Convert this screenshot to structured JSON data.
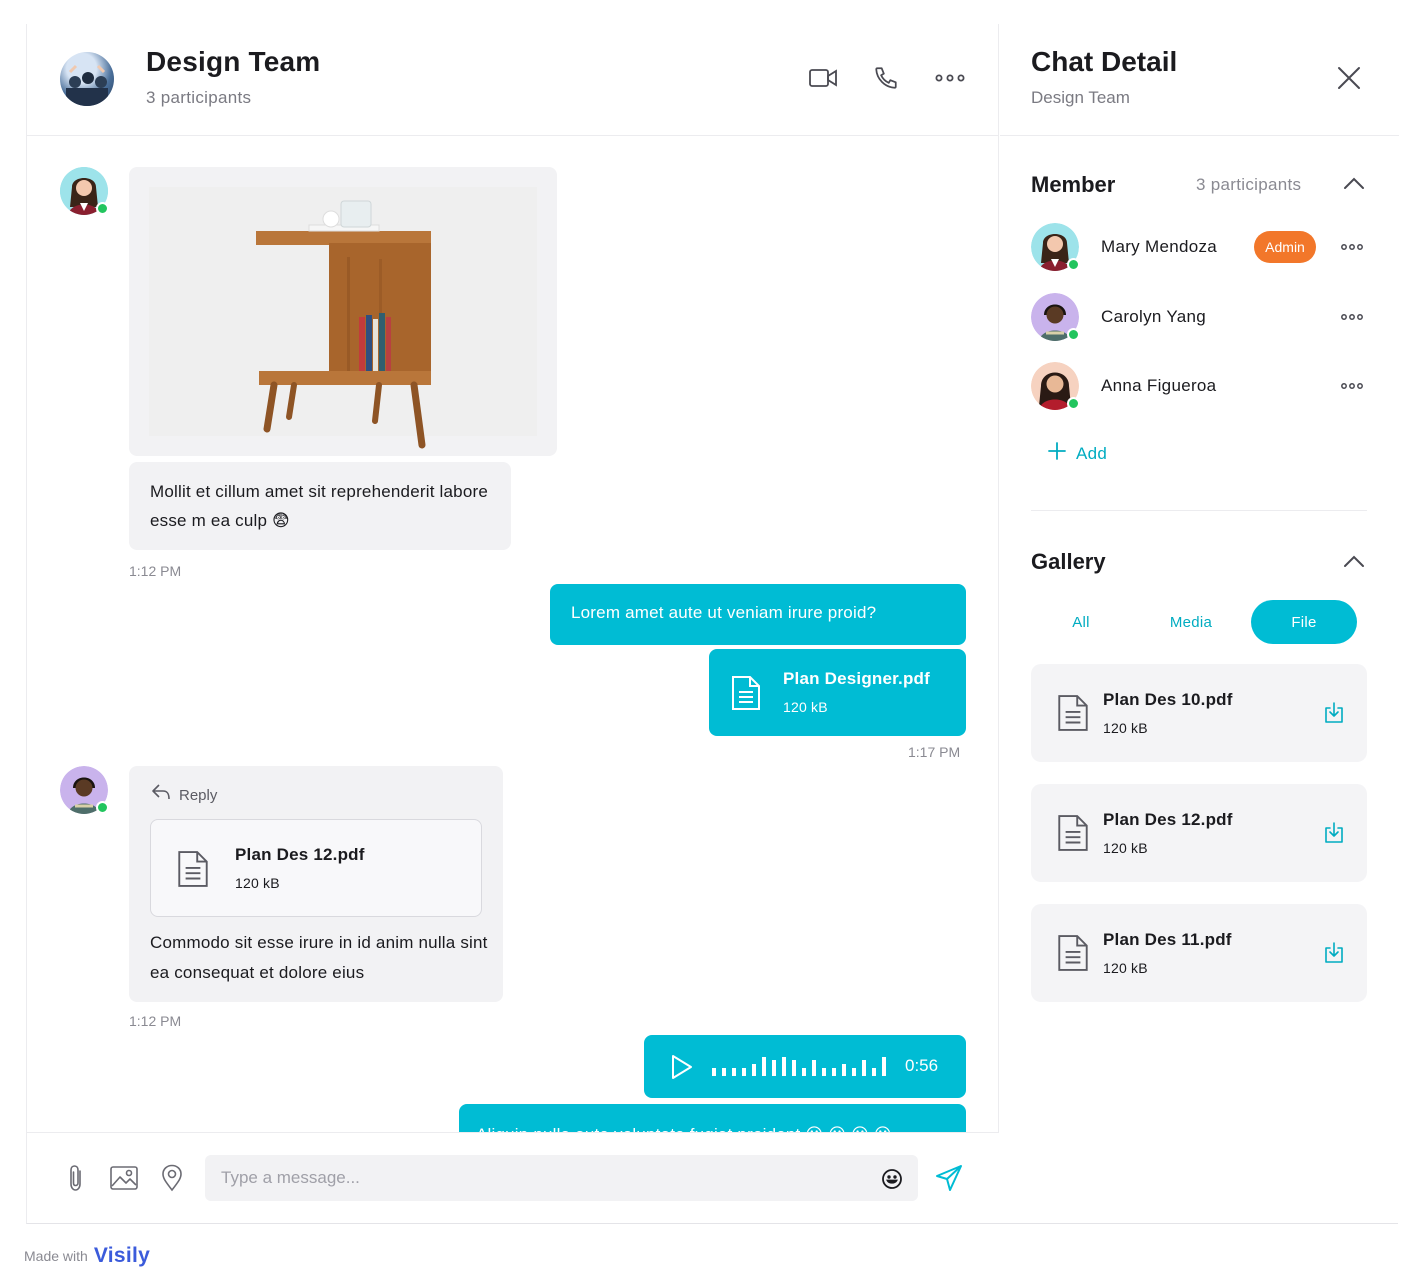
{
  "chat": {
    "title": "Design Team",
    "participants": "3 participants",
    "header_icons": [
      "video-camera-icon",
      "phone-icon",
      "more-horizontal-icon"
    ]
  },
  "messages": {
    "m1_text": "Mollit et cillum amet sit reprehenderit labore esse m ea culp 😨",
    "m1_time": "1:12 PM",
    "m2_text": "Lorem amet aute ut veniam irure proid?",
    "m3_file_name": "Plan Designer.pdf",
    "m3_file_size": "120 kB",
    "m3_time": "1:17 PM",
    "m4_reply_label": "Reply",
    "m4_file_name": "Plan Des 12.pdf",
    "m4_file_size": "120 kB",
    "m4_text": "Commodo sit esse irure in id anim nulla sint ea consequat et dolore eius",
    "m4_time": "1:12 PM",
    "m5_duration": "0:56",
    "m6_text": "Aliquip nulla aute voluptate fugiat proident 😀 😀 😀 😀"
  },
  "composer": {
    "placeholder": "Type a message..."
  },
  "detail": {
    "title": "Chat Detail",
    "subtitle": "Design Team",
    "member_title": "Member",
    "member_count": "3 participants",
    "members": [
      {
        "name": "Mary Mendoza",
        "badge": "Admin"
      },
      {
        "name": "Carolyn Yang"
      },
      {
        "name": "Anna Figueroa"
      }
    ],
    "add_label": "Add",
    "gallery_title": "Gallery",
    "tabs": [
      "All",
      "Media",
      "File"
    ],
    "active_tab": "File",
    "files": [
      {
        "name": "Plan Des 10.pdf",
        "size": "120 kB"
      },
      {
        "name": "Plan Des 12.pdf",
        "size": "120 kB"
      },
      {
        "name": "Plan Des 11.pdf",
        "size": "120 kB"
      }
    ]
  },
  "footer": {
    "made_with": "Made with",
    "brand": "Visily"
  },
  "colors": {
    "accent": "#00bcd4",
    "admin_badge": "#f2772a",
    "online": "#22c55e",
    "bubble_in": "#f2f2f4"
  }
}
